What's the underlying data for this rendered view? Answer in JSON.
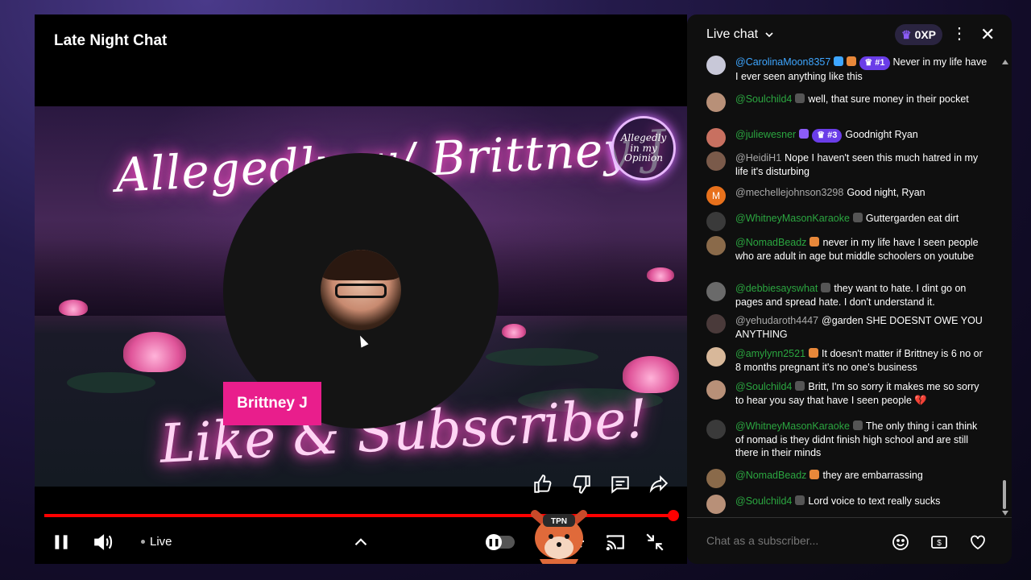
{
  "player": {
    "title": "Late Night Chat",
    "banner_text": "Allegedly w/ Brittney J",
    "logo_text": "Allegedly in my Opinion",
    "subscribe_text": "Like & Subscribe!",
    "speaker_name": "Brittney J",
    "live_label": "Live",
    "fox_badge": "TPN",
    "progress_fraction": 1.0,
    "accent_color": "#ff0000",
    "name_tag_color": "#e91e8c"
  },
  "chat": {
    "title": "Live chat",
    "xp_label": "0XP",
    "input_placeholder": "Chat as a subscriber...",
    "messages": [
      {
        "author": "@CarolinaMoon8357",
        "rank": "#1",
        "text": "Never in my life have I ever seen anything like this",
        "author_color": "blue"
      },
      {
        "author": "@Soulchild4",
        "rank": "",
        "text": "well, that sure money in their pocket",
        "author_color": "green"
      },
      {
        "author": "@juliewesner",
        "rank": "#3",
        "text": "Goodnight Ryan",
        "author_color": "green"
      },
      {
        "author": "@HeidiH1",
        "rank": "",
        "text": "Nope I haven't seen this much hatred in my life it's disturbing",
        "author_color": "grey"
      },
      {
        "author": "@mechellejohnson3298",
        "rank": "",
        "text": "Good night, Ryan",
        "author_color": "grey",
        "avatar_letter": "M"
      },
      {
        "author": "@WhitneyMasonKaraoke",
        "rank": "",
        "text": "Guttergarden eat dirt",
        "author_color": "green"
      },
      {
        "author": "@NomadBeadz",
        "rank": "",
        "text": "never in my life have I seen people who are adult in age but middle schoolers on youtube",
        "author_color": "green"
      },
      {
        "author": "@debbiesayswhat",
        "rank": "",
        "text": "they want to hate. I dint go on pages and spread hate. I don't understand it.",
        "author_color": "green"
      },
      {
        "author": "@yehudaroth4447",
        "rank": "",
        "text": "@garden SHE DOESNT OWE YOU ANYTHING",
        "author_color": "grey"
      },
      {
        "author": "@amylynn2521",
        "rank": "",
        "text": "It doesn't matter if Brittney is 6 no or 8 months pregnant it's no one's business",
        "author_color": "green"
      },
      {
        "author": "@Soulchild4",
        "rank": "",
        "text": "Britt, I'm so sorry it makes me so sorry to hear you say that have I seen people 💔",
        "author_color": "green"
      },
      {
        "author": "@WhitneyMasonKaraoke",
        "rank": "",
        "text": "The only thing i can think of nomad is they didnt finish high school and are still there in their minds",
        "author_color": "green"
      },
      {
        "author": "@NomadBeadz",
        "rank": "",
        "text": "they are embarrassing",
        "author_color": "green"
      },
      {
        "author": "@Soulchild4",
        "rank": "",
        "text": "Lord voice to text really sucks",
        "author_color": "green"
      }
    ]
  }
}
